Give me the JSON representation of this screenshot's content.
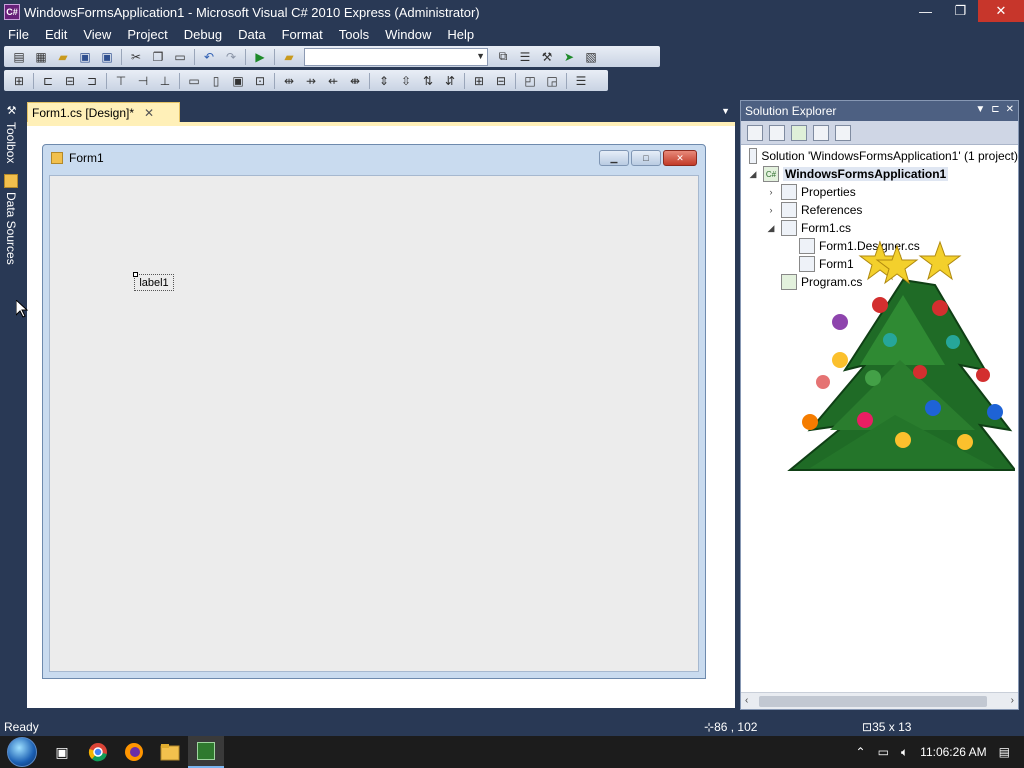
{
  "window": {
    "title": "WindowsFormsApplication1 - Microsoft Visual C# 2010 Express (Administrator)",
    "app_icon_text": "C#",
    "minimize_glyph": "—",
    "maximize_glyph": "❐",
    "close_glyph": "✕"
  },
  "menu": {
    "items": [
      "File",
      "Edit",
      "View",
      "Project",
      "Debug",
      "Data",
      "Format",
      "Tools",
      "Window",
      "Help"
    ]
  },
  "toolbox_strip": {
    "toolbox_label": "Toolbox",
    "data_sources_label": "Data Sources"
  },
  "document": {
    "tab_label": "Form1.cs [Design]*",
    "tab_close": "✕",
    "tab_dropdown": "▼"
  },
  "designer_form": {
    "title": "Form1",
    "label1_text": "label1"
  },
  "solution_explorer": {
    "title": "Solution Explorer",
    "header_icons": [
      "▼",
      "⊏",
      "✕"
    ],
    "tree": [
      {
        "label": "Solution 'WindowsFormsApplication1' (1 project)",
        "expander": "",
        "indent": 0,
        "icon": "solution-icon"
      },
      {
        "label": "WindowsFormsApplication1",
        "expander": "◢",
        "indent": 1,
        "icon": "csharp-project-icon",
        "selected": true
      },
      {
        "label": "Properties",
        "expander": "›",
        "indent": 2,
        "icon": "properties-icon"
      },
      {
        "label": "References",
        "expander": "›",
        "indent": 2,
        "icon": "references-icon"
      },
      {
        "label": "Form1.cs",
        "expander": "◢",
        "indent": 2,
        "icon": "form-icon"
      },
      {
        "label": "Form1.Designer.cs",
        "expander": "",
        "indent": 3,
        "icon": "cs-file-icon"
      },
      {
        "label": "Form1",
        "expander": "",
        "indent": 3,
        "icon": "cs-file-icon"
      },
      {
        "label": "Program.cs",
        "expander": "",
        "indent": 2,
        "icon": "cs-file-icon"
      }
    ]
  },
  "statusbar": {
    "status": "Ready",
    "position": "86 , 102",
    "size": "35 x 13"
  },
  "taskbar": {
    "time": "11:06:26 AM"
  }
}
